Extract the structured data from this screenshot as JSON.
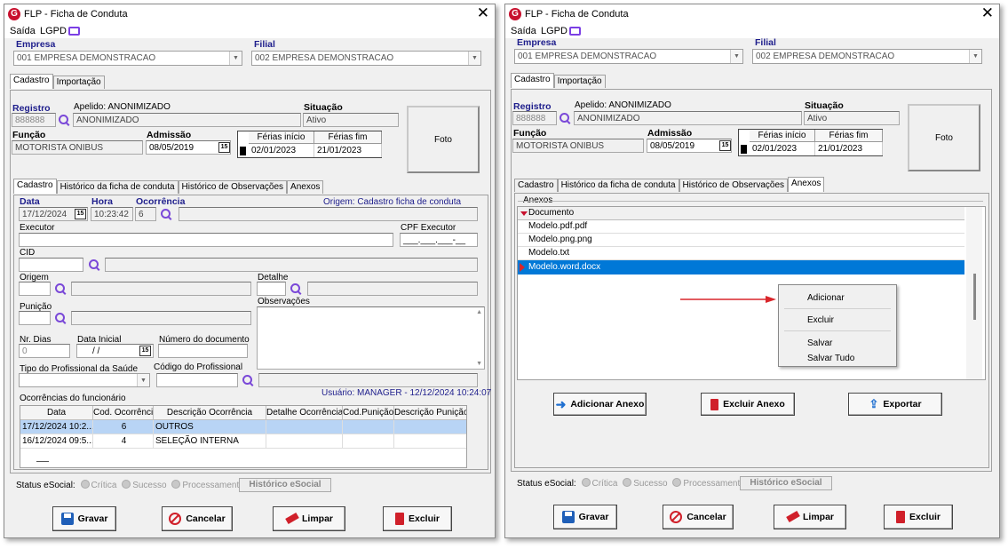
{
  "window_title": "FLP - Ficha de Conduta",
  "menu": {
    "saida": "Saída",
    "lgpd": "LGPD"
  },
  "empresa": {
    "label": "Empresa",
    "value": "001 EMPRESA DEMONSTRACAO"
  },
  "filial": {
    "label": "Filial",
    "value": "002 EMPRESA DEMONSTRACAO"
  },
  "main_tabs": {
    "cadastro": "Cadastro",
    "importacao": "Importação"
  },
  "registro": {
    "label": "Registro",
    "value": "888888"
  },
  "apelido": {
    "label": "Apelido: ANONIMIZADO",
    "value": "ANONIMIZADO"
  },
  "situacao": {
    "label": "Situação",
    "value": "Ativo"
  },
  "funcao": {
    "label": "Função",
    "value": "MOTORISTA ONIBUS"
  },
  "admissao": {
    "label": "Admissão",
    "value": "08/05/2019"
  },
  "ferias": {
    "inicio_label": "Férias início",
    "fim_label": "Férias fim",
    "inicio": "02/01/2023",
    "fim": "21/01/2023"
  },
  "foto_label": "Foto",
  "sub_tabs": {
    "cadastro": "Cadastro",
    "historico_ficha": "Histórico da ficha de conduta",
    "historico_obs": "Histórico de Observações",
    "anexos": "Anexos"
  },
  "form": {
    "data_label": "Data",
    "data_value": "17/12/2024",
    "hora_label": "Hora",
    "hora_value": "10:23:42",
    "ocorrencia_label": "Ocorrência",
    "ocorrencia_value": "6",
    "origem_text": "Origem: Cadastro ficha de conduta",
    "executor_label": "Executor",
    "cpf_label": "CPF Executor",
    "cpf_mask": "___.___.___-__",
    "cid_label": "CID",
    "origem_label": "Origem",
    "detalhe_label": "Detalhe",
    "punicao_label": "Punição",
    "observacoes_label": "Observações",
    "nrdias_label": "Nr. Dias",
    "nrdias_value": "0",
    "datainicial_label": "Data Inicial",
    "datainicial_value": "/ /",
    "numdoc_label": "Número do documento",
    "tipoprof_label": "Tipo do Profissional da Saúde",
    "codprof_label": "Código do Profissional",
    "ocorrencias_label": "Ocorrências do funcionário",
    "usuario_text": "Usuário: MANAGER - 12/12/2024 10:24:07"
  },
  "grid": {
    "headers": [
      "Data",
      "Cod. Ocorrência",
      "Descrição Ocorrência",
      "Detalhe Ocorrência",
      "Cod.Punição",
      "Descrição Punição"
    ],
    "rows": [
      [
        "17/12/2024 10:2...",
        "6",
        "OUTROS",
        "",
        "",
        ""
      ],
      [
        "16/12/2024 09:5...",
        "4",
        "SELEÇÃO INTERNA",
        "",
        "",
        ""
      ]
    ]
  },
  "status_esocial": {
    "label": "Status eSocial:",
    "critica": "Crítica",
    "sucesso": "Sucesso",
    "processamento": "Processamento",
    "historico": "Histórico eSocial"
  },
  "buttons": {
    "gravar": "Gravar",
    "cancelar": "Cancelar",
    "limpar": "Limpar",
    "excluir": "Excluir"
  },
  "anexos": {
    "group_label": "Anexos",
    "column": "Documento",
    "files": [
      "Modelo.pdf.pdf",
      "Modelo.png.png",
      "Modelo.txt",
      "Modelo.word.docx"
    ],
    "selected_index": 3,
    "context_menu": [
      "Adicionar",
      "Excluir",
      "Salvar",
      "Salvar Tudo"
    ],
    "btn_adicionar": "Adicionar Anexo",
    "btn_excluir": "Excluir Anexo",
    "btn_exportar": "Exportar"
  },
  "colors": {
    "label_blue": "#1e1e8c",
    "selected_row": "#0078d7",
    "arrow": "#d9262b",
    "logo": "#c8102e"
  }
}
